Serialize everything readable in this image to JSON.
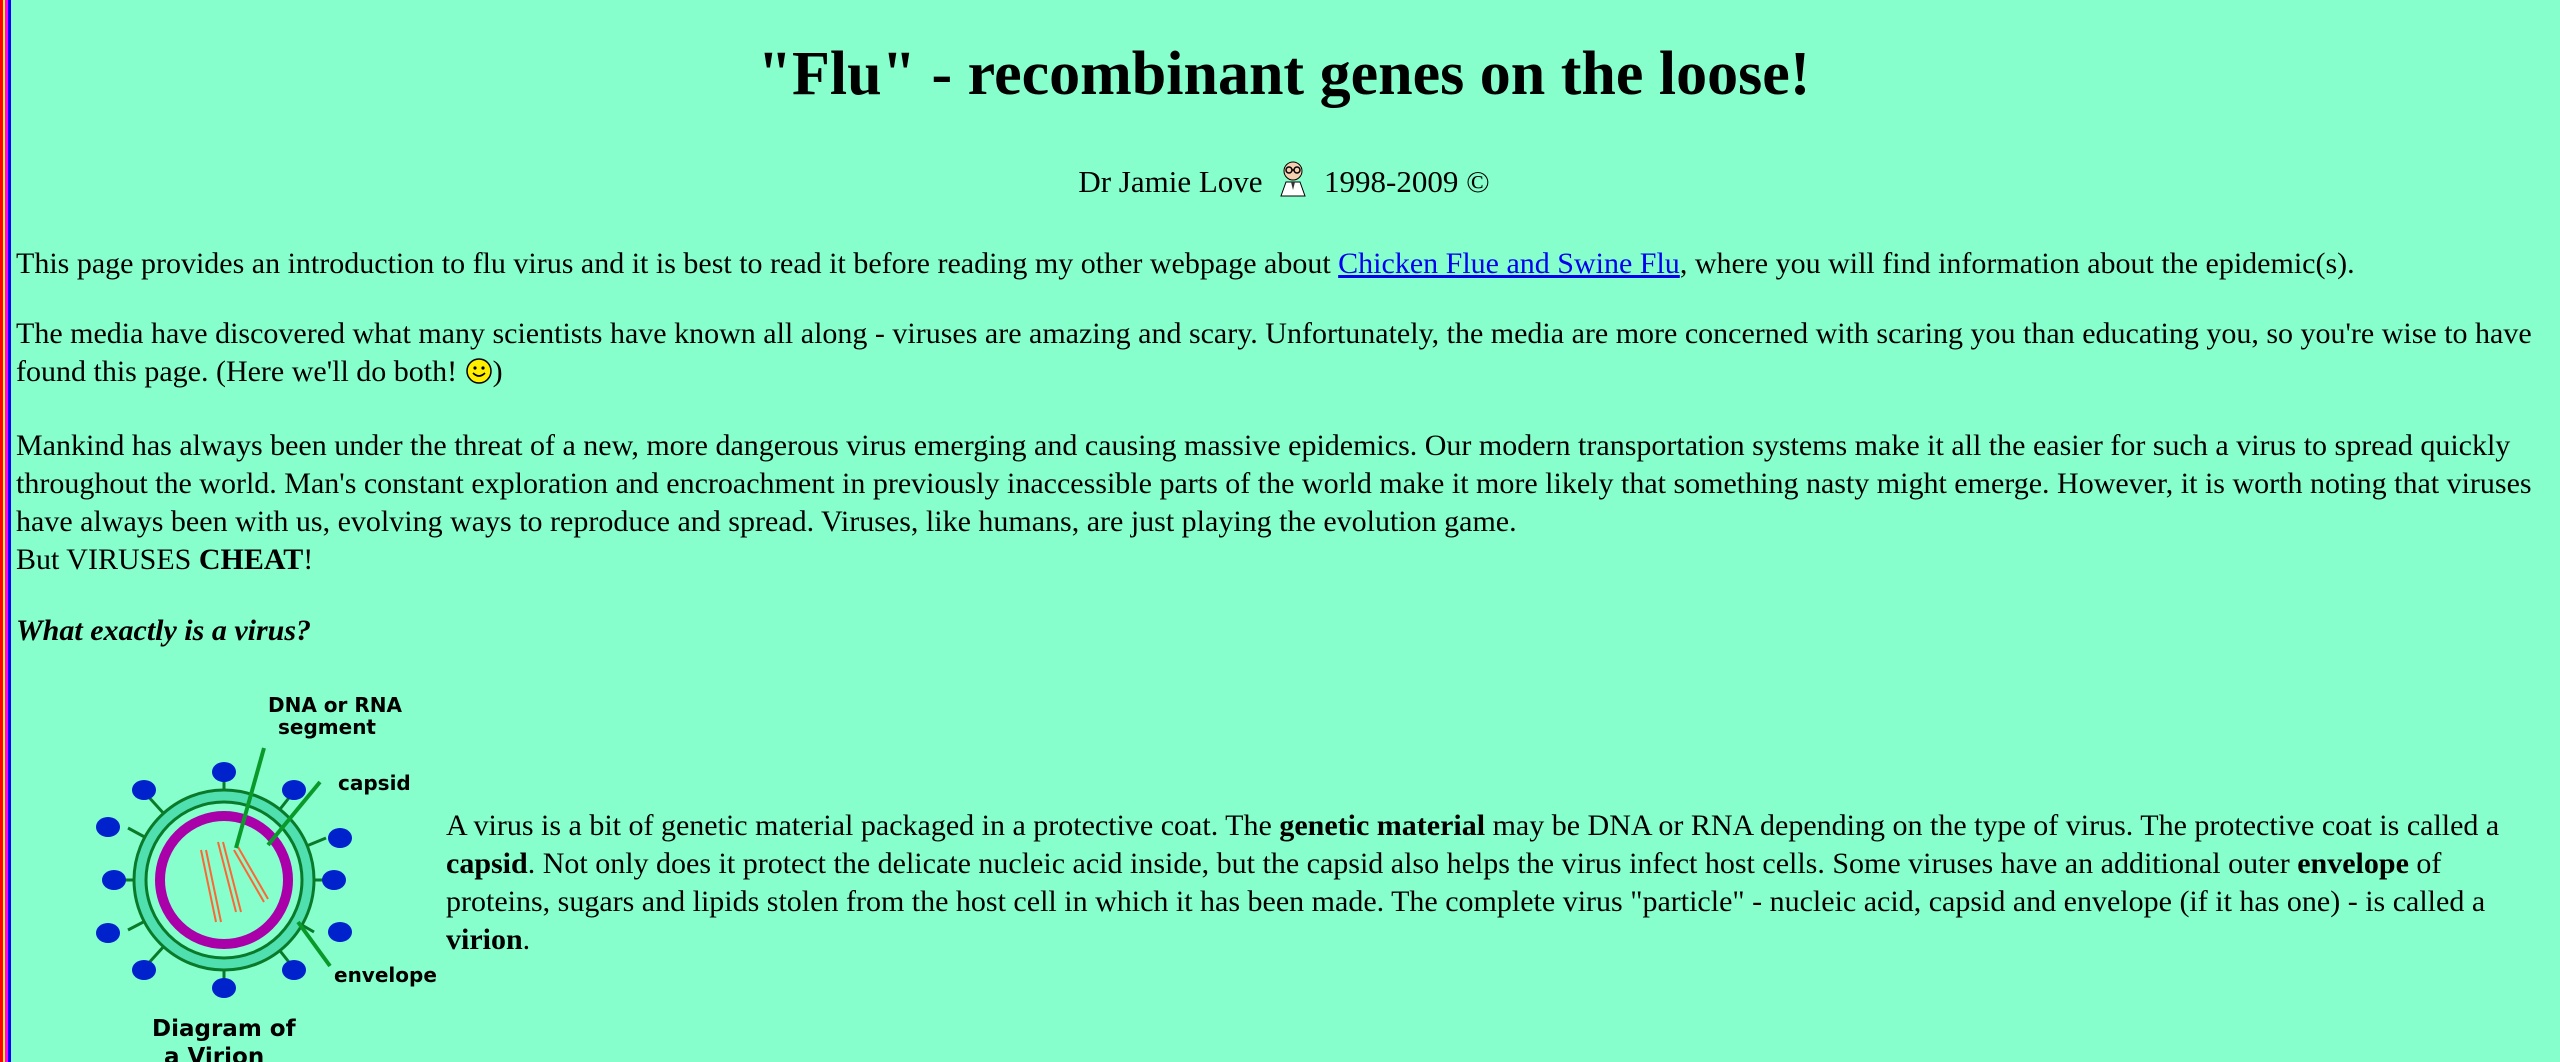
{
  "title": "\"Flu\" - recombinant genes on the loose!",
  "byline": {
    "author": "Dr Jamie Love",
    "years": "1998-2009 ©"
  },
  "para1": {
    "before": "This page provides an introduction to flu virus and it is best to read it before reading my other webpage about ",
    "link": "Chicken Flue and Swine Flu",
    "after": ", where you will find information about the epidemic(s)."
  },
  "para2": {
    "text": "The media have discovered what many scientists have known all along - viruses are amazing and scary. Unfortunately, the media are more concerned with scaring you than educating you, so you're wise to have found this page. (Here we'll do both! ",
    "close": ")"
  },
  "para3": {
    "text": "Mankind has always been under the threat of a new, more dangerous virus emerging and causing massive epidemics. Our modern transportation systems make it all the easier for such a virus to spread quickly throughout the world. Man's constant exploration and encroachment in previously inaccessible parts of the world make it more likely that something nasty might emerge. However, it is worth noting that viruses have always been with us, evolving ways to reproduce and spread. Viruses, like humans, are just playing the evolution game.",
    "line2_before": "But VIRUSES ",
    "line2_bold": "CHEAT",
    "line2_after": "!"
  },
  "question": "What exactly is a virus?",
  "diagram": {
    "label_dna": "DNA or RNA",
    "label_segment": "segment",
    "label_capsid": "capsid",
    "label_envelope": "envelope",
    "caption1": "Diagram of",
    "caption2": "a Virion"
  },
  "para4": {
    "t1": "A virus is a bit of genetic material packaged in a protective coat. The ",
    "b1": "genetic material",
    "t2": " may be DNA or RNA depending on the type of virus. The protective coat is called a ",
    "b2": "capsid",
    "t3": ". Not only does it protect the delicate nucleic acid inside, but the capsid also helps the virus infect host cells. Some viruses have an additional outer ",
    "b3": "envelope",
    "t4": " of proteins, sugars and lipids stolen from the host cell in which it has been made. The complete virus \"particle\" - nucleic acid, capsid and envelope (if it has one) - is called a ",
    "b4": "virion",
    "t5": "."
  },
  "colors": {
    "background": "#86ffcc",
    "link": "#0000ee"
  }
}
